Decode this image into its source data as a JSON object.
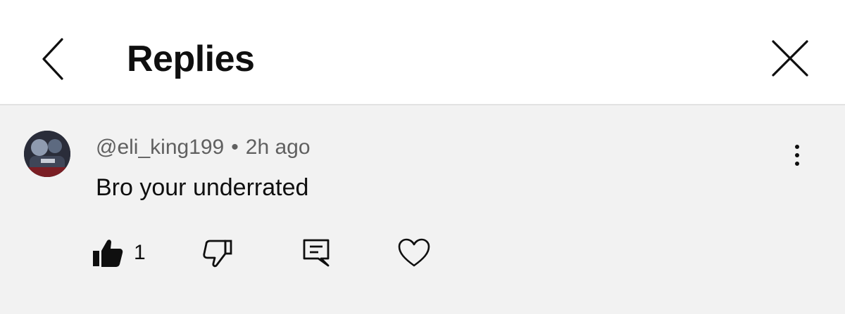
{
  "header": {
    "title": "Replies",
    "back_icon": "chevron-left-icon",
    "close_icon": "close-icon"
  },
  "comment": {
    "username": "@eli_king199",
    "separator": "•",
    "time": "2h ago",
    "text": "Bro your underrated",
    "like_count": "1",
    "avatar": "user-avatar"
  },
  "actions": {
    "like_icon": "thumbs-up-icon",
    "dislike_icon": "thumbs-down-icon",
    "reply_icon": "reply-icon",
    "heart_icon": "heart-icon",
    "more_icon": "more-vertical-icon"
  },
  "colors": {
    "header_bg": "#ffffff",
    "content_bg": "#f2f2f2",
    "text_primary": "#0f0f0f",
    "text_secondary": "#606060",
    "divider": "#e2e2e2"
  }
}
